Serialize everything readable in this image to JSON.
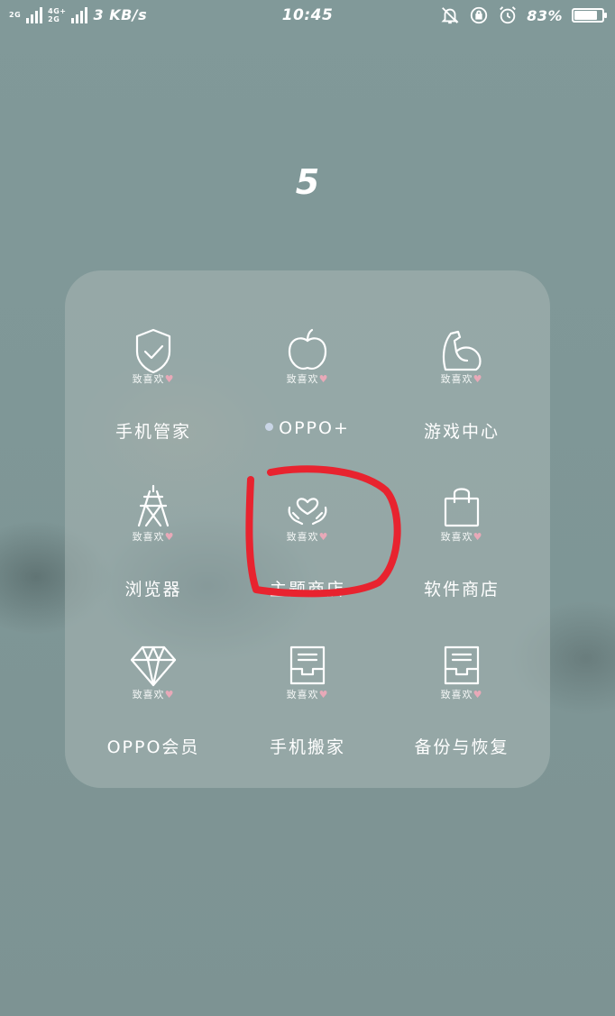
{
  "status_bar": {
    "net_top": "2G",
    "net_mid": "4G+",
    "net_bottom": "2G",
    "speed": "3 KB/s",
    "time": "10:45",
    "battery_percent": "83%",
    "battery_level": 0.83,
    "icons": [
      "mute-vibrate-icon",
      "rotation-lock-icon",
      "alarm-icon"
    ]
  },
  "folder": {
    "title": "5",
    "apps": [
      {
        "icon": "shield-check-icon",
        "tag": "致喜欢",
        "label": "手机管家",
        "dot": false
      },
      {
        "icon": "apple-icon",
        "tag": "致喜欢",
        "label": "OPPO+",
        "dot": true
      },
      {
        "icon": "muscle-arm-icon",
        "tag": "致喜欢",
        "label": "游戏中心",
        "dot": false
      },
      {
        "icon": "tower-icon",
        "tag": "致喜欢",
        "label": "浏览器",
        "dot": false
      },
      {
        "icon": "hands-heart-icon",
        "tag": "致喜欢",
        "label": "主题商店",
        "dot": false
      },
      {
        "icon": "shopping-bag-icon",
        "tag": "致喜欢",
        "label": "软件商店",
        "dot": false
      },
      {
        "icon": "diamond-icon",
        "tag": "致喜欢",
        "label": "OPPO会员",
        "dot": false
      },
      {
        "icon": "inbox-tray-icon",
        "tag": "致喜欢",
        "label": "手机搬家",
        "dot": false
      },
      {
        "icon": "inbox-tray-icon",
        "tag": "致喜欢",
        "label": "备份与恢复",
        "dot": false
      }
    ]
  },
  "colors": {
    "background": "#7d9393",
    "folder": "#a8b7b5",
    "annotation": "#e8232f",
    "heart": "#e8a9b8"
  }
}
